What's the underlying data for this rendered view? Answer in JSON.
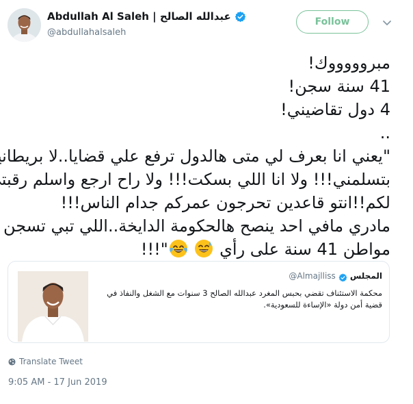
{
  "author": {
    "display_name": "Abdullah Al Saleh | عبدالله الصالح",
    "handle": "@abdullahalsaleh",
    "verified": true
  },
  "actions": {
    "follow_label": "Follow"
  },
  "tweet": {
    "lines": [
      "مبروووووك!",
      "41 سنة سجن!",
      "4 دول تقاضيني!",
      "..",
      "\"يعني انا بعرف لي متى هالدول ترفع علي قضايا..لا بريطانيا",
      "بتسلمني!!! ولا انا اللي بسكت!!! ولا راح ارجع واسلم رقبتي",
      "لكم!!انتو قاعدين تحرجون عمركم جدام الناس!!!",
      "مادري مافي احد ينصح هالحكومة الدايخة..اللي تبي تسجن",
      "مواطن 41 سنة على رأي"
    ],
    "last_line_suffix": "\"!!!",
    "emojis": [
      "sweat-smile-emoji",
      "tears-of-joy-emoji"
    ]
  },
  "quoted_tweet": {
    "name": "المجلس",
    "handle": "@Almajlliss",
    "verified": true,
    "text": "محكمة الاستئناف تقضي بحبس المغرد عبدالله الصالح 3 سنوات مع الشغل والنفاذ في قضية أمن دولة «الإساءة للسعودية»."
  },
  "translate_label": "Translate Tweet",
  "timestamp": "9:05 AM - 17 Jun 2019",
  "colors": {
    "verified": "#1da1f2",
    "follow": "#79c29a",
    "muted": "#657786"
  }
}
